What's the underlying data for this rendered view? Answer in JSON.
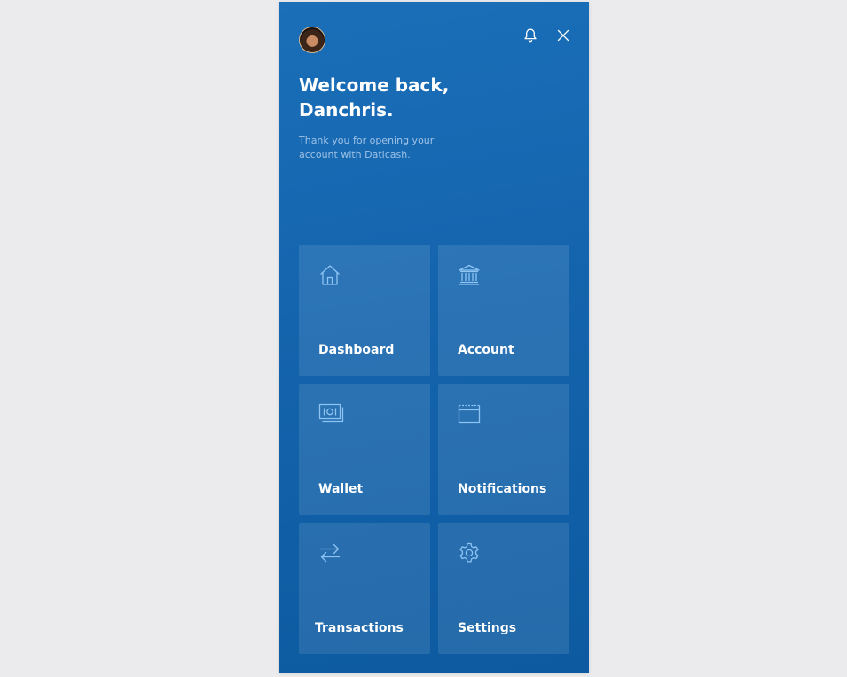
{
  "header": {
    "welcome_line1": "Welcome back,",
    "welcome_line2": "Danchris.",
    "subtitle": "Thank you for opening your account with Daticash.",
    "icons": {
      "avatar": "user-avatar",
      "notifications": "bell-icon",
      "close": "close-icon"
    }
  },
  "tiles": [
    {
      "label": "Dashboard",
      "icon": "home-icon"
    },
    {
      "label": "Account",
      "icon": "bank-icon"
    },
    {
      "label": "Wallet",
      "icon": "wallet-icon"
    },
    {
      "label": "Notifications",
      "icon": "window-icon"
    },
    {
      "label": "Transactions",
      "icon": "transfer-icon"
    },
    {
      "label": "Settings",
      "icon": "gear-icon"
    }
  ],
  "colors": {
    "panel": "#1466ae",
    "icon_stroke": "#8ec4f4",
    "page_background": "#ebebee"
  }
}
